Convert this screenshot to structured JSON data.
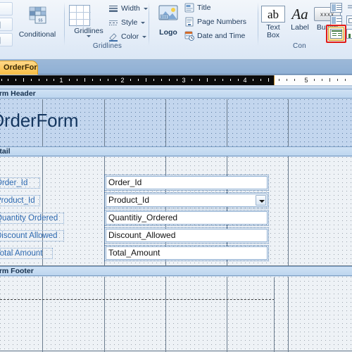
{
  "ribbon": {
    "groups": [
      {
        "label": "",
        "items": [
          "Conditional"
        ]
      },
      {
        "label": "Gridlines",
        "items": [
          "Gridlines",
          "Width",
          "Style",
          "Color"
        ]
      },
      {
        "label": "",
        "items": [
          "Logo",
          "Title",
          "Page Numbers",
          "Date and Time"
        ]
      },
      {
        "label": "Con",
        "items": [
          "Text Box",
          "Label",
          "Button"
        ]
      }
    ],
    "conditional_label": "Conditional",
    "gridlines_button_label": "Gridlines",
    "gridlines_group_label": "Gridlines",
    "width_label": "Width",
    "style_label": "Style",
    "color_label": "Color",
    "logo_label": "Logo",
    "title_label": "Title",
    "page_numbers_label": "Page Numbers",
    "date_time_label": "Date and Time",
    "text_box_label": "Text\nBox",
    "text_box_line1": "Text",
    "text_box_line2": "Box",
    "text_box_icon_text": "ab",
    "label_label": "Label",
    "label_icon_text": "Aa",
    "button_label": "Button",
    "button_icon_text": "xxxx",
    "controls_group_label": "Con",
    "highlight_color": "#e21b16"
  },
  "document_tab": {
    "label": "OrderForm"
  },
  "ruler": {
    "numbers": [
      "1",
      "2",
      "3",
      "4",
      "5"
    ],
    "inverted_until": "4.5"
  },
  "form": {
    "sections": [
      {
        "name": "Form Header",
        "label": "Form Header"
      },
      {
        "name": "Detail",
        "label": "Detail"
      },
      {
        "name": "Form Footer",
        "label": "Form Footer"
      }
    ],
    "header_label": "Form Header",
    "detail_label": "Detail",
    "footer_label": "Form Footer",
    "title_control": {
      "text": "OrderForm",
      "selected": true
    },
    "rows": [
      {
        "label": "Order_Id",
        "value": "Order_Id",
        "type": "textbox",
        "selected": true
      },
      {
        "label": "Product_Id",
        "value": "Product_Id",
        "type": "combobox",
        "selected": true
      },
      {
        "label": "Quantity Ordered",
        "value": "Quantitiy_Ordered",
        "type": "textbox",
        "selected": true
      },
      {
        "label": "Discount Allowed",
        "value": "Discount_Allowed",
        "type": "textbox",
        "selected": true
      },
      {
        "label": "Total Amount",
        "value": "Total_Amount",
        "type": "textbox",
        "selected": true
      }
    ]
  },
  "colors": {
    "selection_blue": "#c3d6ee",
    "label_blue": "#2e6ab1",
    "title_blue": "#14365f",
    "tab_orange": "#fcc95f",
    "ribbon_bg": "#e6eef8"
  }
}
